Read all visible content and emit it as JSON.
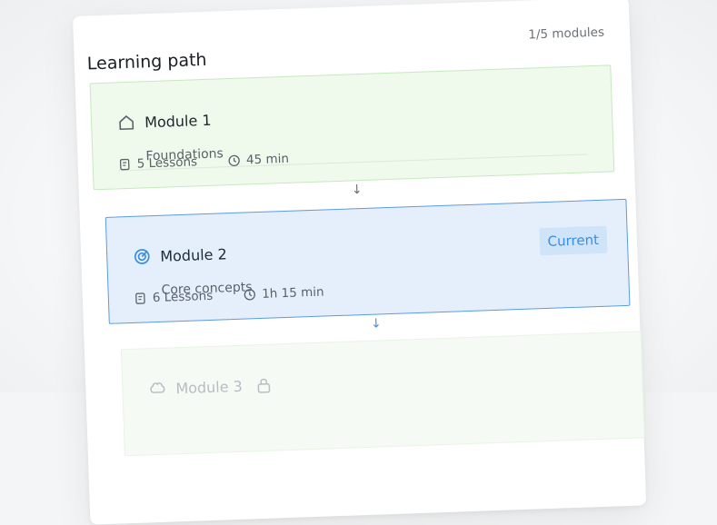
{
  "header": {
    "title": "Learning path",
    "progress": "1/5 modules"
  },
  "modules": [
    {
      "name": "Module 1",
      "description": "Foundations",
      "lessons": "5 Lessons",
      "duration": "45 min"
    },
    {
      "name": "Module 2",
      "description": "Core concepts",
      "lessons": "6 Lessons",
      "duration": "1h 15 min",
      "badge": "Current"
    },
    {
      "name": "Module 3"
    }
  ],
  "colors": {
    "accent": "#3a8ee0",
    "completed_bg": "#eff9ec",
    "current_bg": "#e4effb",
    "current_border": "#5c9be0"
  },
  "icons": [
    "home-icon",
    "target-icon",
    "lessons-icon",
    "clock-icon",
    "lock-icon",
    "arrow-down-icon"
  ]
}
